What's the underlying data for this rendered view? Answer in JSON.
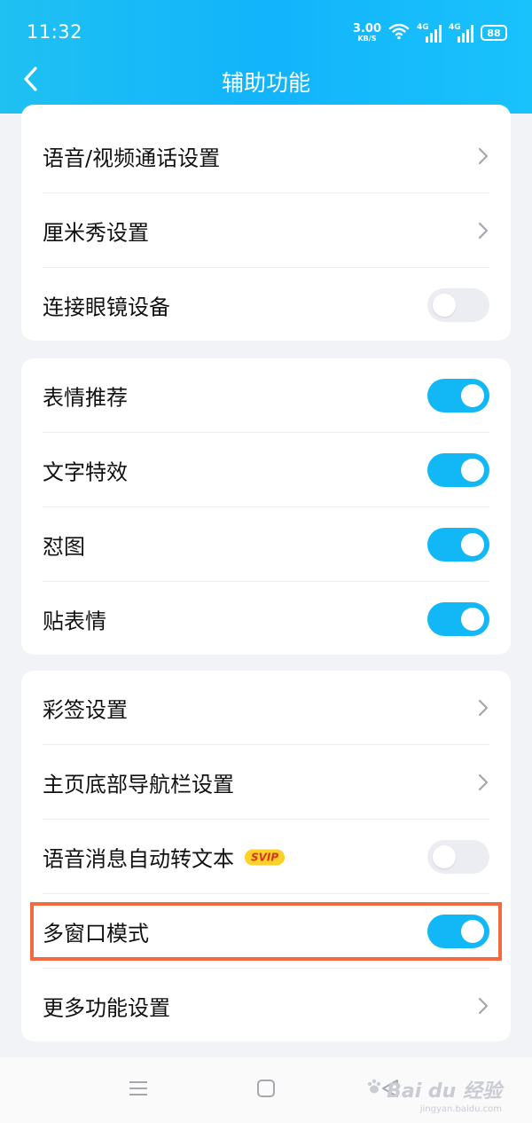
{
  "status_bar": {
    "time": "11:32",
    "net_speed_value": "3.00",
    "net_speed_unit": "KB/S",
    "signal1_label": "4G",
    "signal2_label": "4G",
    "battery": "88"
  },
  "header": {
    "title": "辅助功能",
    "back_icon": "chevron-left-icon"
  },
  "sections": [
    {
      "items": [
        {
          "label": "语音/视频通话设置",
          "control": "chevron"
        },
        {
          "label": "厘米秀设置",
          "control": "chevron"
        },
        {
          "label": "连接眼镜设备",
          "control": "toggle",
          "on": false
        }
      ]
    },
    {
      "items": [
        {
          "label": "表情推荐",
          "control": "toggle",
          "on": true
        },
        {
          "label": "文字特效",
          "control": "toggle",
          "on": true
        },
        {
          "label": "怼图",
          "control": "toggle",
          "on": true
        },
        {
          "label": "贴表情",
          "control": "toggle",
          "on": true
        }
      ]
    },
    {
      "items": [
        {
          "label": "彩签设置",
          "control": "chevron"
        },
        {
          "label": "主页底部导航栏设置",
          "control": "chevron"
        },
        {
          "label": "语音消息自动转文本",
          "control": "toggle",
          "on": false,
          "badge": "SVIP"
        },
        {
          "label": "多窗口模式",
          "control": "toggle",
          "on": true,
          "highlighted": true
        },
        {
          "label": "更多功能设置",
          "control": "chevron"
        }
      ]
    }
  ],
  "colors": {
    "header_gradient_start": "#1fc1f2",
    "header_gradient_end": "#19c2fb",
    "toggle_on": "#12b7f5",
    "toggle_off": "#ebedf2",
    "highlight_border": "#f26a3e",
    "page_background": "#f2f3f7"
  },
  "watermark": {
    "logo": "Bai du 经验",
    "url": "jingyan.baidu.com"
  }
}
